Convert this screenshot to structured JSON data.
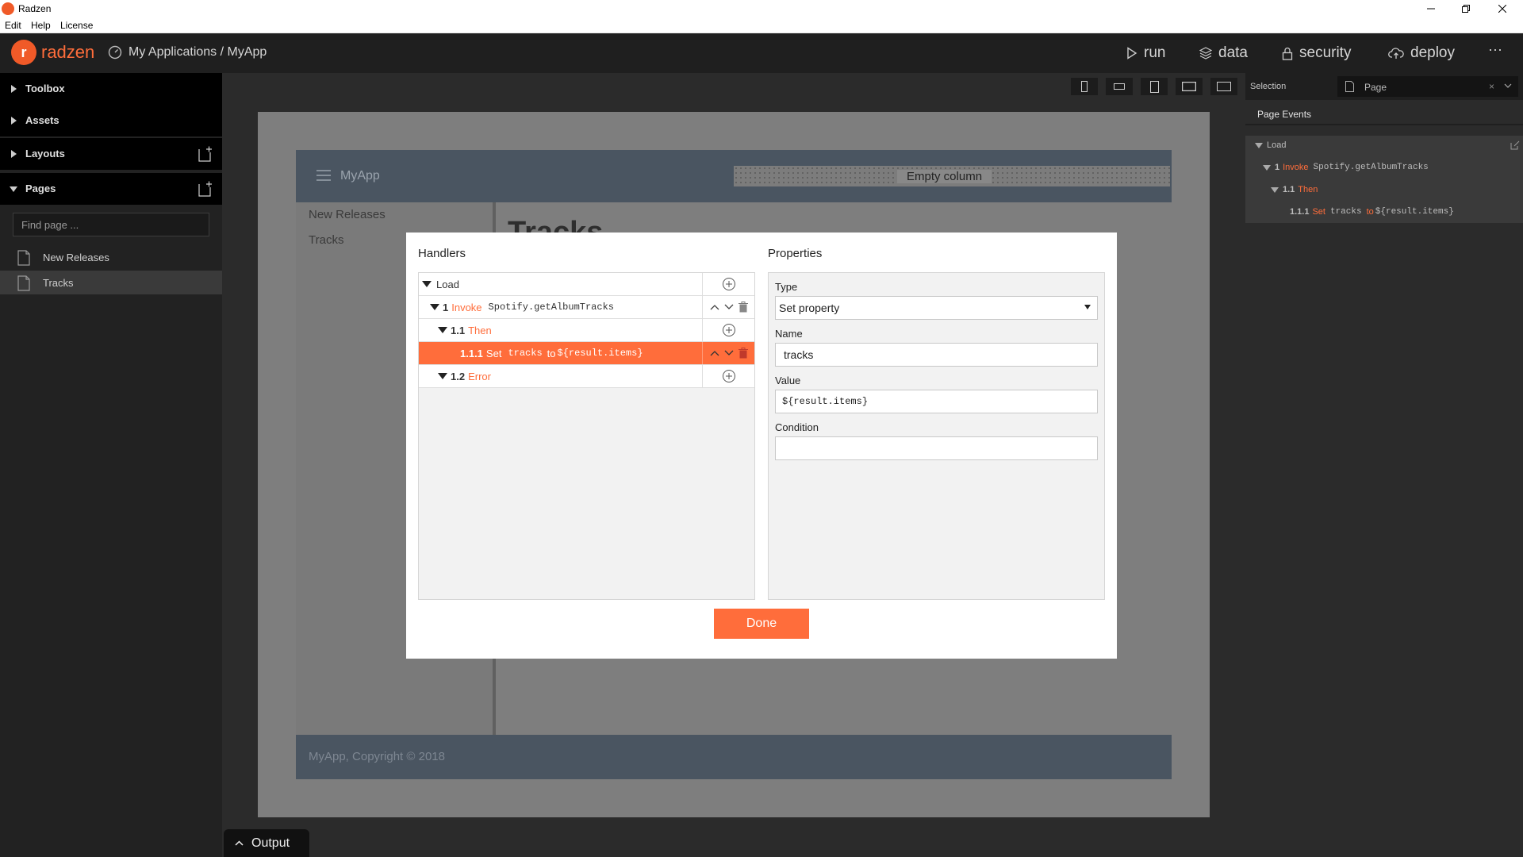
{
  "window": {
    "title": "Radzen"
  },
  "menu": {
    "items": [
      "Edit",
      "Help",
      "License"
    ]
  },
  "header": {
    "brand": "radzen",
    "breadcrumb": "My Applications / MyApp",
    "nav": {
      "run": "run",
      "data": "data",
      "security": "security",
      "deploy": "deploy",
      "more": "···"
    }
  },
  "sidebar": {
    "sections": {
      "toolbox": "Toolbox",
      "assets": "Assets",
      "layouts": "Layouts",
      "pages": "Pages"
    },
    "find_placeholder": "Find page ...",
    "pages": [
      "New Releases",
      "Tracks"
    ],
    "selected_page": "Tracks"
  },
  "canvas": {
    "app_name": "MyApp",
    "empty_column": "Empty column",
    "nav_items": [
      "New Releases",
      "Tracks"
    ],
    "page_title": "Tracks",
    "footer": "MyApp, Copyright © 2018"
  },
  "output": {
    "label": "Output"
  },
  "right_panel": {
    "selection_label": "Selection",
    "selection_value": "Page",
    "clear": "×",
    "events_title": "Page Events",
    "tree": {
      "load": "Load",
      "invoke_num": "1",
      "invoke_kw": "Invoke",
      "invoke_target": "Spotify.getAlbumTracks",
      "then_num": "1.1",
      "then_kw": "Then",
      "set_num": "1.1.1",
      "set_kw": "Set",
      "set_name": "tracks",
      "set_to": "to",
      "set_value": "${result.items}"
    }
  },
  "modal": {
    "handlers_title": "Handlers",
    "properties_title": "Properties",
    "handlers": {
      "load": "Load",
      "invoke_num": "1",
      "invoke_kw": "Invoke",
      "invoke_target": "Spotify.getAlbumTracks",
      "then_num": "1.1",
      "then_kw": "Then",
      "set_num": "1.1.1",
      "set_kw": "Set",
      "set_name": "tracks",
      "set_to": "to",
      "set_value": "${result.items}",
      "error_num": "1.2",
      "error_kw": "Error"
    },
    "properties": {
      "type_label": "Type",
      "type_value": "Set property",
      "name_label": "Name",
      "name_value": "tracks",
      "value_label": "Value",
      "value_value": "${result.items}",
      "condition_label": "Condition",
      "condition_value": ""
    },
    "done": "Done"
  },
  "colors": {
    "accent": "#ff6d3b",
    "sidebar_bg": "#222222",
    "header_bg": "#1f1f1f",
    "app_header": "#4a5561"
  }
}
